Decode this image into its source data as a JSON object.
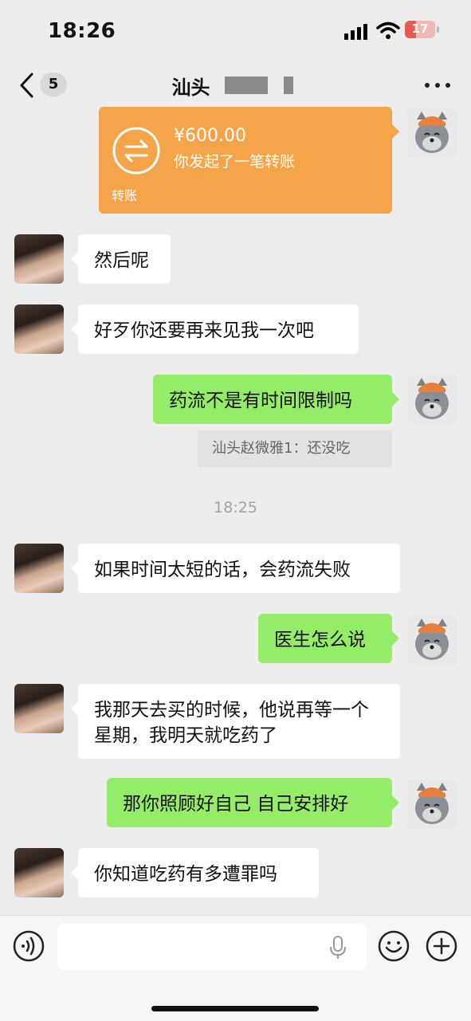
{
  "status_bar": {
    "time": "18:26",
    "battery": "17"
  },
  "nav": {
    "unread_count": "5",
    "title": "汕头"
  },
  "transfer": {
    "amount": "¥600.00",
    "description": "你发起了一笔转账",
    "label": "转账"
  },
  "messages": [
    {
      "side": "left",
      "text": "然后呢"
    },
    {
      "side": "left",
      "text": "好歹你还要再来见我一次吧"
    },
    {
      "side": "right",
      "text": "药流不是有时间限制吗"
    },
    {
      "side": "left",
      "text": "如果时间太短的话，会药流失败"
    },
    {
      "side": "right",
      "text": "医生怎么说"
    },
    {
      "side": "left",
      "text": "我那天去买的时候，他说再等一个星期，我明天就吃药了"
    },
    {
      "side": "right",
      "text": "那你照顾好自己 自己安排好"
    },
    {
      "side": "left",
      "text": "你知道吃药有多遭罪吗"
    }
  ],
  "quote": {
    "text": "汕头赵微雅1：还没吃"
  },
  "timestamp": "18:25",
  "input": {
    "value": ""
  }
}
